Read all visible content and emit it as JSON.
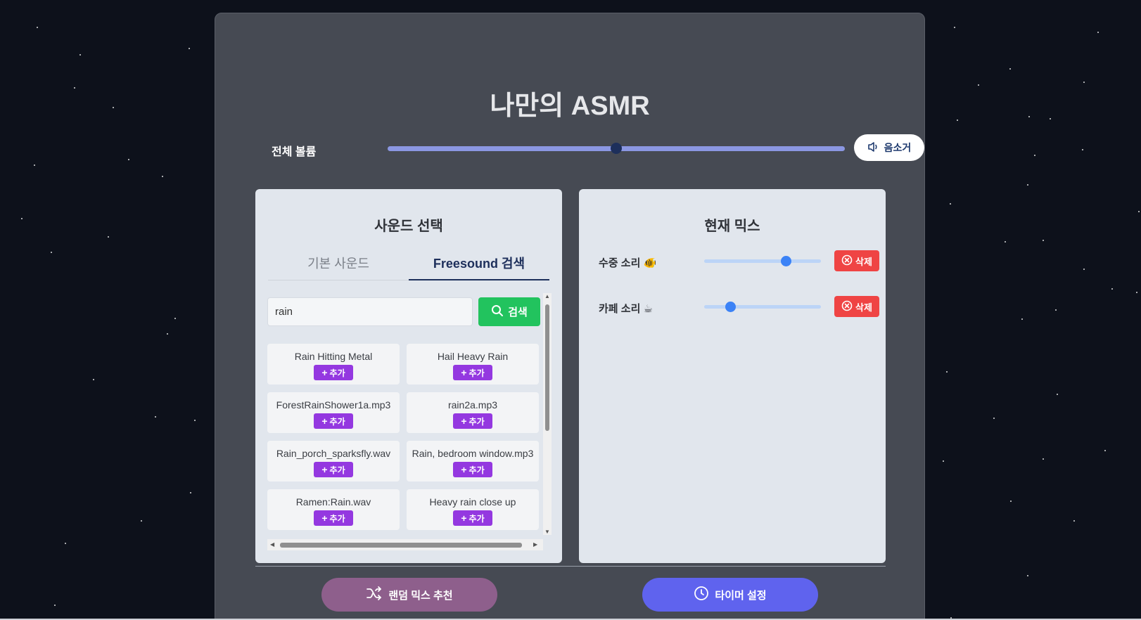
{
  "app": {
    "title": "나만의 ASMR"
  },
  "master_volume": {
    "label": "전체 볼륨",
    "level_percent": 50,
    "mute_label": "음소거",
    "mute_icon": "speaker-icon"
  },
  "sound_select": {
    "title": "사운드 선택",
    "tabs": [
      {
        "label": "기본 사운드",
        "active": false
      },
      {
        "label": "Freesound 검색",
        "active": true
      }
    ],
    "search": {
      "value": "rain",
      "button_label": "검색",
      "button_icon": "search-icon"
    },
    "add_label": "추가",
    "results": [
      {
        "name": "Rain Hitting Metal"
      },
      {
        "name": "Hail Heavy Rain"
      },
      {
        "name": "ForestRainShower1a.mp3"
      },
      {
        "name": "rain2a.mp3"
      },
      {
        "name": "Rain_porch_sparksfly.wav"
      },
      {
        "name": "Rain, bedroom window.mp3"
      },
      {
        "name": "Ramen:Rain.wav"
      },
      {
        "name": "Heavy rain close up"
      }
    ]
  },
  "current_mix": {
    "title": "현재 믹스",
    "delete_label": "삭제",
    "items": [
      {
        "label": "수중 소리 🐠",
        "volume_percent": 70
      },
      {
        "label": "카페 소리 ☕",
        "volume_percent": 22
      }
    ]
  },
  "actions": {
    "random_mix": "랜덤 믹스 추천",
    "timer": "타이머 설정"
  },
  "colors": {
    "accent_purple": "#9438e0",
    "search_green": "#22c35e",
    "delete_red": "#ef4444",
    "timer_blue": "#5f63ee",
    "random_mauve": "#8e5f8c"
  }
}
